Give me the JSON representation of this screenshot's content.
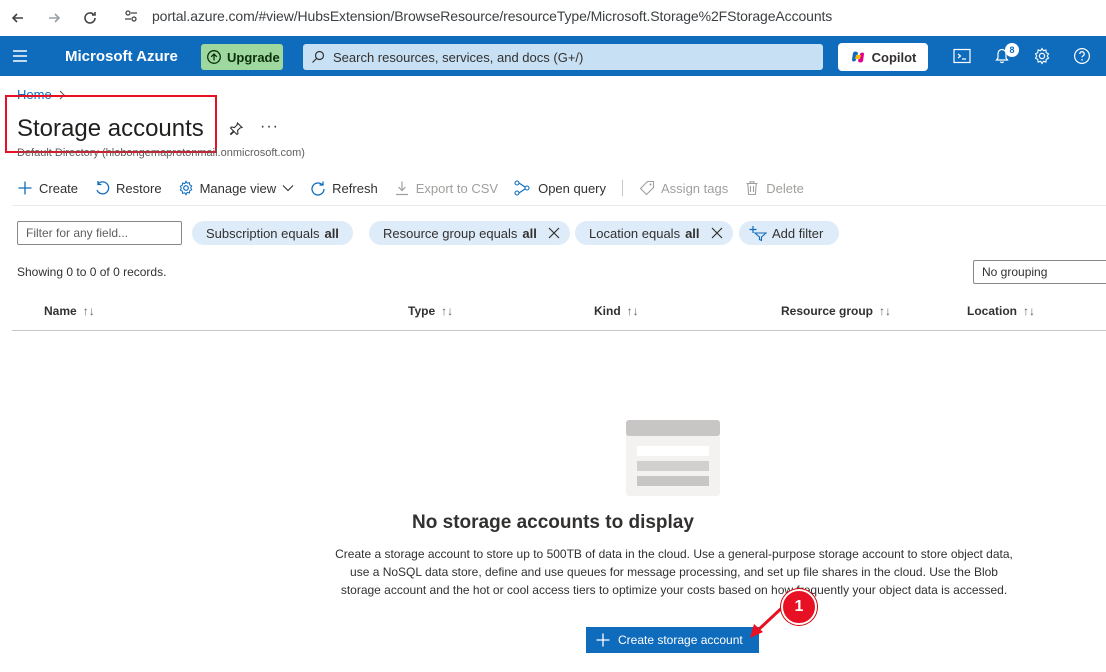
{
  "browser": {
    "url": "portal.azure.com/#view/HubsExtension/BrowseResource/resourceType/Microsoft.Storage%2FStorageAccounts"
  },
  "header": {
    "brand": "Microsoft Azure",
    "upgrade_label": "Upgrade",
    "search_placeholder": "Search resources, services, and docs (G+/)",
    "copilot_label": "Copilot",
    "notification_count": "8"
  },
  "page": {
    "breadcrumb": "Home",
    "title": "Storage accounts",
    "subtitle": "Default Directory (hlobongemaprotonmail.onmicrosoft.com)",
    "more_label": "···"
  },
  "commands": {
    "create": "Create",
    "restore": "Restore",
    "manage_view": "Manage view",
    "refresh": "Refresh",
    "export_csv": "Export to CSV",
    "open_query": "Open query",
    "assign_tags": "Assign tags",
    "delete": "Delete"
  },
  "filters": {
    "placeholder": "Filter for any field...",
    "subscription_prefix": "Subscription equals",
    "subscription_value": "all",
    "resource_group_prefix": "Resource group equals",
    "resource_group_value": "all",
    "location_prefix": "Location equals",
    "location_value": "all",
    "add_filter": "Add filter"
  },
  "records_text": "Showing 0 to 0 of 0 records.",
  "grouping": "No grouping",
  "columns": [
    "Name",
    "Type",
    "Kind",
    "Resource group",
    "Location"
  ],
  "sort_glyph": "↑↓",
  "empty": {
    "title": "No storage accounts to display",
    "description": "Create a storage account to store up to 500TB of data in the cloud. Use a general-purpose storage account to store object data, use a NoSQL data store, define and use queues for message processing, and set up file shares in the cloud. Use the Blob storage account and the hot or cool access tiers to optimize your costs based on how frequently your object data is accessed.",
    "cta": "Create storage account"
  },
  "annotation": {
    "marker": "1"
  },
  "colors": {
    "azure_blue": "#0f6cbd",
    "highlight_red": "#e81123",
    "pill_bg": "#deecf9"
  }
}
